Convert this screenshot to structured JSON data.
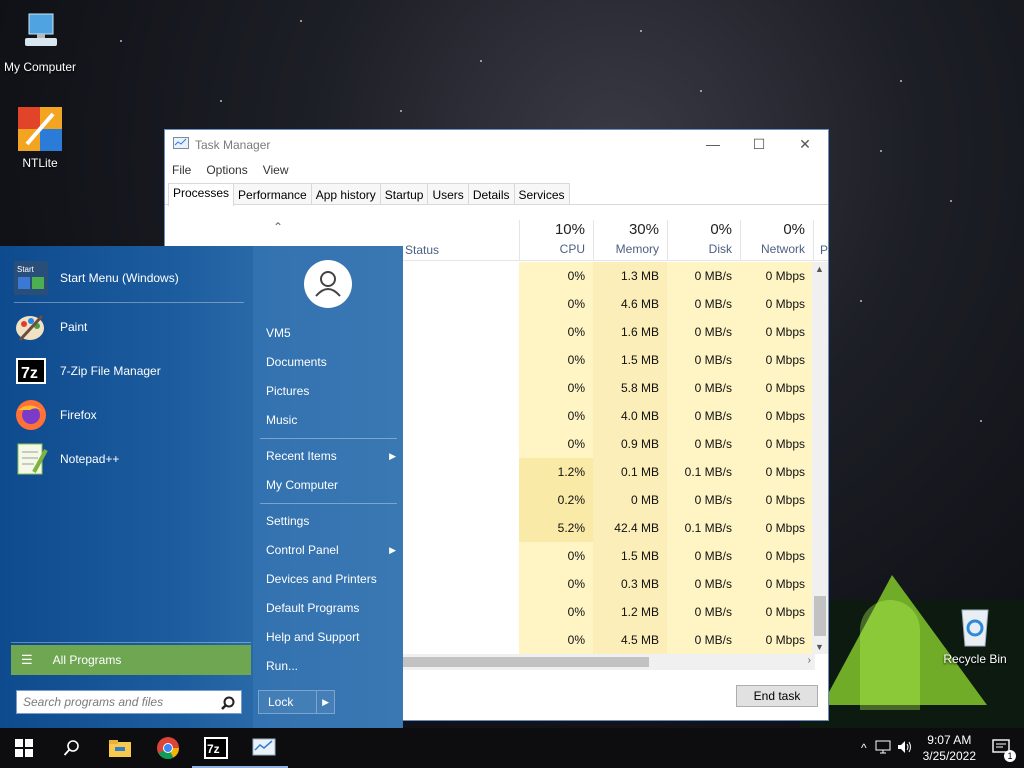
{
  "desktop": {
    "icons": [
      {
        "label": "My Computer",
        "icon": "computer-icon"
      },
      {
        "label": "NTLite",
        "icon": "ntlite-icon"
      },
      {
        "label": "Recycle Bin",
        "icon": "recycle-bin-icon"
      }
    ]
  },
  "task_manager": {
    "title": "Task Manager",
    "menu": [
      "File",
      "Options",
      "View"
    ],
    "tabs": [
      "Processes",
      "Performance",
      "App history",
      "Startup",
      "Users",
      "Details",
      "Services"
    ],
    "active_tab": "Processes",
    "columns": {
      "status": "Status",
      "cpu": {
        "pct": "10%",
        "label": "CPU"
      },
      "memory": {
        "pct": "30%",
        "label": "Memory"
      },
      "disk": {
        "pct": "0%",
        "label": "Disk"
      },
      "network": {
        "pct": "0%",
        "label": "Network"
      },
      "power_partial": "P"
    },
    "rows": [
      {
        "cpu": "0%",
        "memory": "1.3 MB",
        "disk": "0 MB/s",
        "network": "0 Mbps"
      },
      {
        "cpu": "0%",
        "memory": "4.6 MB",
        "disk": "0 MB/s",
        "network": "0 Mbps"
      },
      {
        "cpu": "0%",
        "memory": "1.6 MB",
        "disk": "0 MB/s",
        "network": "0 Mbps"
      },
      {
        "cpu": "0%",
        "memory": "1.5 MB",
        "disk": "0 MB/s",
        "network": "0 Mbps"
      },
      {
        "cpu": "0%",
        "memory": "5.8 MB",
        "disk": "0 MB/s",
        "network": "0 Mbps"
      },
      {
        "cpu": "0%",
        "memory": "4.0 MB",
        "disk": "0 MB/s",
        "network": "0 Mbps"
      },
      {
        "cpu": "0%",
        "memory": "0.9 MB",
        "disk": "0 MB/s",
        "network": "0 Mbps"
      },
      {
        "cpu": "1.2%",
        "memory": "0.1 MB",
        "disk": "0.1 MB/s",
        "network": "0 Mbps"
      },
      {
        "cpu": "0.2%",
        "memory": "0 MB",
        "disk": "0 MB/s",
        "network": "0 Mbps"
      },
      {
        "cpu": "5.2%",
        "memory": "42.4 MB",
        "disk": "0.1 MB/s",
        "network": "0 Mbps"
      },
      {
        "cpu": "0%",
        "memory": "1.5 MB",
        "disk": "0 MB/s",
        "network": "0 Mbps"
      },
      {
        "cpu": "0%",
        "memory": "0.3 MB",
        "disk": "0 MB/s",
        "network": "0 Mbps"
      },
      {
        "cpu": "0%",
        "memory": "1.2 MB",
        "disk": "0 MB/s",
        "network": "0 Mbps"
      },
      {
        "cpu": "0%",
        "memory": "4.5 MB",
        "disk": "0 MB/s",
        "network": "0 Mbps"
      }
    ],
    "end_task": "End task"
  },
  "start_menu": {
    "programs": [
      {
        "label": "Start Menu (Windows)",
        "icon": "start-menu-app-icon"
      },
      {
        "label": "Paint",
        "icon": "paint-icon"
      },
      {
        "label": "7-Zip File Manager",
        "icon": "7zip-icon"
      },
      {
        "label": "Firefox",
        "icon": "firefox-icon"
      },
      {
        "label": "Notepad++",
        "icon": "notepadpp-icon"
      }
    ],
    "start_app_badge": "Start",
    "all_programs": "All Programs",
    "search_placeholder": "Search programs and files",
    "right": {
      "user": "VM5",
      "documents": "Documents",
      "pictures": "Pictures",
      "music": "Music",
      "recent_items": "Recent Items",
      "my_computer": "My Computer",
      "settings": "Settings",
      "control_panel": "Control Panel",
      "devices_printers": "Devices and Printers",
      "default_programs": "Default Programs",
      "help_support": "Help and Support",
      "run": "Run..."
    },
    "lock": "Lock"
  },
  "taskbar": {
    "items": [
      "windows-logo-icon",
      "search-icon",
      "file-explorer-icon",
      "chrome-icon",
      "7zip-icon",
      "task-manager-icon"
    ],
    "time": "9:07 AM",
    "date": "3/25/2022",
    "notification_count": "1",
    "zip_badge": "7z"
  }
}
